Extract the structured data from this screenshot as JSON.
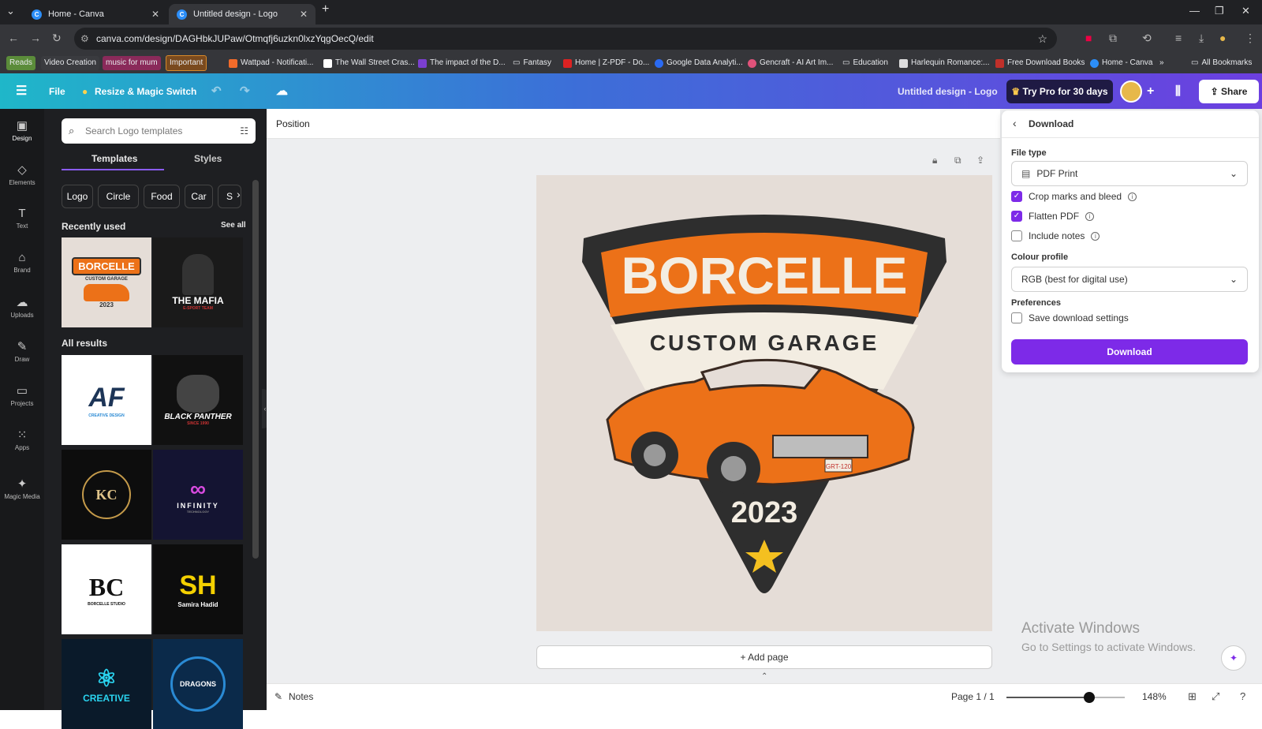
{
  "browser": {
    "tabs": [
      {
        "title": "Home - Canva",
        "active": false
      },
      {
        "title": "Untitled design - Logo",
        "active": true
      }
    ],
    "url": "canva.com/design/DAGHbkJUPaw/Otmqfj6uzkn0lxzYqgOecQ/edit",
    "bookmarks": [
      "Reads",
      "Video Creation",
      "music for mum",
      "Important",
      "Wattpad - Notificati...",
      "The Wall Street Cras...",
      "The impact of the D...",
      "Fantasy",
      "Home | Z-PDF - Do...",
      "Google Data Analyti...",
      "Gencraft - AI Art Im...",
      "Education",
      "Harlequin Romance:...",
      "Free Download Books",
      "Home - Canva",
      "All Bookmarks"
    ]
  },
  "header": {
    "file": "File",
    "resize": "Resize & Magic Switch",
    "design_title": "Untitled design - Logo",
    "try_pro": "Try Pro for 30 days",
    "share": "Share"
  },
  "rail": [
    "Design",
    "Elements",
    "Text",
    "Brand",
    "Uploads",
    "Draw",
    "Projects",
    "Apps",
    "Magic Media"
  ],
  "panel": {
    "search_placeholder": "Search Logo templates",
    "tabs": [
      "Templates",
      "Styles"
    ],
    "chips": [
      "Logo",
      "Circle",
      "Food",
      "Car",
      "S"
    ],
    "recently_used": "Recently used",
    "see_all": "See all",
    "all_results": "All results",
    "thumbs": [
      {
        "text": "BORCELLE",
        "sub": "CUSTOM GARAGE",
        "extra": "2023"
      },
      {
        "text": "THE MAFIA",
        "sub": "E-SPORT TEAM"
      },
      {
        "text": "AF",
        "sub": "CREATIVE DESIGN"
      },
      {
        "text": "BLACK PANTHER",
        "sub": "SINCE 1990"
      },
      {
        "text": "KC",
        "sub": ""
      },
      {
        "text": "INFINITY",
        "sub": "TECHNOLOGY"
      },
      {
        "text": "BC",
        "sub": "BORCELLE STUDIO"
      },
      {
        "text": "SH",
        "sub": "Samira Hadid"
      },
      {
        "text": "CREATIVE",
        "sub": ""
      },
      {
        "text": "DRAGONS",
        "sub": ""
      }
    ]
  },
  "canvas": {
    "position": "Position",
    "logo_title": "BORCELLE",
    "logo_sub": "CUSTOM GARAGE",
    "logo_year": "2023",
    "plate": "GRT-120",
    "add_page": "+ Add page",
    "notes": "Notes",
    "page": "Page 1 / 1",
    "zoom": "148%",
    "zoom_level": 0.7
  },
  "download": {
    "title": "Download",
    "file_type_label": "File type",
    "file_type": "PDF Print",
    "crop": "Crop marks and bleed",
    "flatten": "Flatten PDF",
    "notes": "Include notes",
    "colour_label": "Colour profile",
    "colour": "RGB (best for digital use)",
    "prefs_label": "Preferences",
    "save": "Save download settings",
    "button": "Download"
  },
  "watermark": {
    "line1": "Activate Windows",
    "line2": "Go to Settings to activate Windows."
  },
  "colors": {
    "accent": "#7d2ae8",
    "logo_orange": "#ec7118",
    "logo_dark": "#2e2e2e",
    "logo_cream": "#f3ede2"
  }
}
